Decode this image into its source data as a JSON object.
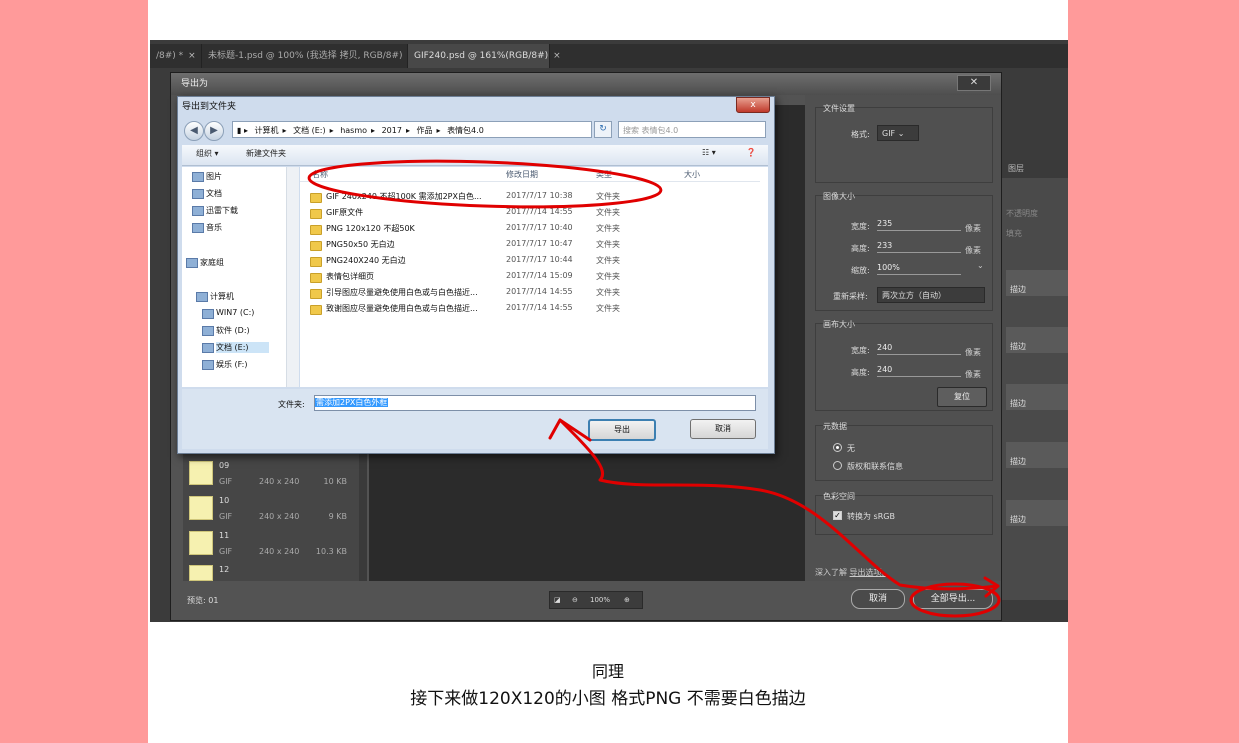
{
  "ps": {
    "tabs": [
      "/8#) *",
      "未标题-1.psd @ 100% (我选择 拷贝, RGB/8#)",
      "GIF240.psd @ 161%(RGB/8#)"
    ],
    "tab_close": "×",
    "panel_header": "图层",
    "panel_opacity": "不透明度",
    "panel_fill": "填充",
    "layer_labels": [
      "描边",
      "描边",
      "描边",
      "描边",
      "描边"
    ]
  },
  "export_dialog": {
    "title": "导出为",
    "close": "✕",
    "thumbs": [
      {
        "name": "09",
        "format": "GIF",
        "dims": "240 x 240",
        "size": "10 KB"
      },
      {
        "name": "10",
        "format": "GIF",
        "dims": "240 x 240",
        "size": "9 KB"
      },
      {
        "name": "11",
        "format": "GIF",
        "dims": "240 x 240",
        "size": "10.3 KB"
      },
      {
        "name": "12",
        "format": "",
        "dims": "",
        "size": ""
      }
    ],
    "file_settings": {
      "title": "文件设置",
      "format_label": "格式:",
      "format_value": "GIF"
    },
    "image_size": {
      "title": "图像大小",
      "width_label": "宽度:",
      "width_value": "235",
      "width_unit": "像素",
      "height_label": "高度:",
      "height_value": "233",
      "height_unit": "像素",
      "scale_label": "缩放:",
      "scale_value": "100%",
      "resample_label": "重新采样:",
      "resample_value": "两次立方（自动）"
    },
    "canvas_size": {
      "title": "画布大小",
      "width_label": "宽度:",
      "width_value": "240",
      "width_unit": "像素",
      "height_label": "高度:",
      "height_value": "240",
      "height_unit": "像素",
      "reset": "复位"
    },
    "metadata": {
      "title": "元数据",
      "option_none": "无",
      "option_copyright": "版权和联系信息"
    },
    "color_space": {
      "title": "色彩空间",
      "convert": "转换为 sRGB"
    },
    "learn_more": "深入了解",
    "learn_more_link": "导出选项。",
    "preview_label": "预览: 01",
    "zoom": "100%",
    "cancel": "取消",
    "export_all": "全部导出..."
  },
  "win_dialog": {
    "title": "导出到文件夹",
    "close": "x",
    "address": [
      "计算机",
      "文档 (E:)",
      "hasmo",
      "2017",
      "作品",
      "表情包4.0"
    ],
    "search_placeholder": "搜索 表情包4.0",
    "toolbar": {
      "organize": "组织 ▾",
      "new_folder": "新建文件夹"
    },
    "nav": [
      "图片",
      "文档",
      "迅雷下载",
      "音乐",
      "家庭组",
      "计算机",
      "WIN7 (C:)",
      "软件 (D:)",
      "文档 (E:)",
      "娱乐 (F:)"
    ],
    "columns": {
      "name": "名称",
      "date": "修改日期",
      "type": "类型",
      "size": "大小"
    },
    "files": [
      {
        "name": "GIF 240x240 不超100K 需添加2PX白色...",
        "date": "2017/7/17 10:38",
        "type": "文件夹"
      },
      {
        "name": "GIF原文件",
        "date": "2017/7/14 14:55",
        "type": "文件夹"
      },
      {
        "name": "PNG 120x120 不超50K",
        "date": "2017/7/17 10:40",
        "type": "文件夹"
      },
      {
        "name": "PNG50x50 无白边",
        "date": "2017/7/17 10:47",
        "type": "文件夹"
      },
      {
        "name": "PNG240X240 无白边",
        "date": "2017/7/17 10:44",
        "type": "文件夹"
      },
      {
        "name": "表情包详细页",
        "date": "2017/7/14 15:09",
        "type": "文件夹"
      },
      {
        "name": "引导图应尽量避免使用白色或与白色描近...",
        "date": "2017/7/14 14:55",
        "type": "文件夹"
      },
      {
        "name": "致谢图应尽量避免使用白色或与白色描近...",
        "date": "2017/7/14 14:55",
        "type": "文件夹"
      }
    ],
    "folder_label": "文件夹:",
    "folder_value": "需添加2PX白色外框",
    "export_btn": "导出",
    "cancel_btn": "取消"
  },
  "caption": {
    "line1": "同理",
    "line2": "接下来做120X120的小图 格式PNG 不需要白色描边"
  },
  "colors": {
    "background": "#ff9a9a",
    "annotation": "#e00000"
  }
}
